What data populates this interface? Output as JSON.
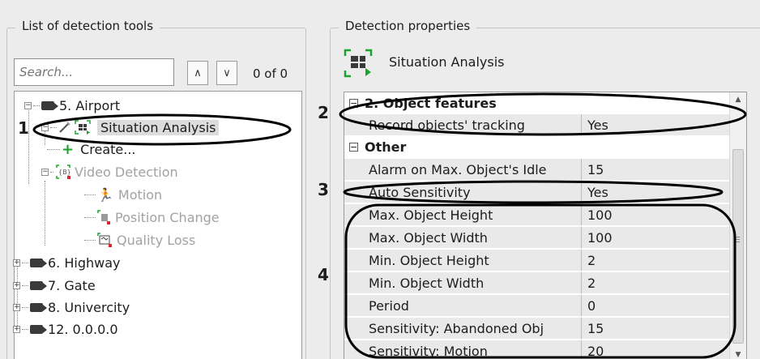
{
  "left_panel": {
    "title": "List of detection tools",
    "search": {
      "placeholder": "Search..."
    },
    "nav_up": "∧",
    "nav_down": "∨",
    "counter": "0 of 0",
    "tree": [
      {
        "label": "5. Airport"
      },
      {
        "label": "Situation Analysis"
      },
      {
        "label": "Create..."
      },
      {
        "label": "Video Detection"
      },
      {
        "label": "Motion"
      },
      {
        "label": "Position Change"
      },
      {
        "label": "Quality Loss"
      },
      {
        "label": "6. Highway"
      },
      {
        "label": "7. Gate"
      },
      {
        "label": "8. Univercity"
      },
      {
        "label": "12. 0.0.0.0"
      }
    ]
  },
  "right_panel": {
    "title": "Detection properties",
    "tool_name": "Situation Analysis",
    "sections": [
      {
        "header": "2. Object features",
        "rows": [
          {
            "name": "Record objects' tracking",
            "value": "Yes"
          }
        ]
      },
      {
        "header": "Other",
        "rows": [
          {
            "name": "Alarm on Max. Object's Idle",
            "value": "15"
          },
          {
            "name": "Auto Sensitivity",
            "value": "Yes"
          },
          {
            "name": "Max. Object Height",
            "value": "100"
          },
          {
            "name": "Max. Object Width",
            "value": "100"
          },
          {
            "name": "Min. Object Height",
            "value": "2"
          },
          {
            "name": "Min. Object Width",
            "value": "2"
          },
          {
            "name": "Period",
            "value": "0"
          },
          {
            "name": "Sensitivity: Abandoned Obj",
            "value": "15"
          },
          {
            "name": "Sensitivity: Motion",
            "value": "20"
          }
        ]
      }
    ]
  },
  "callouts": [
    "1",
    "2",
    "3",
    "4"
  ],
  "colors": {
    "accent_green": "#19a52b",
    "marker_red": "#d8262a"
  }
}
